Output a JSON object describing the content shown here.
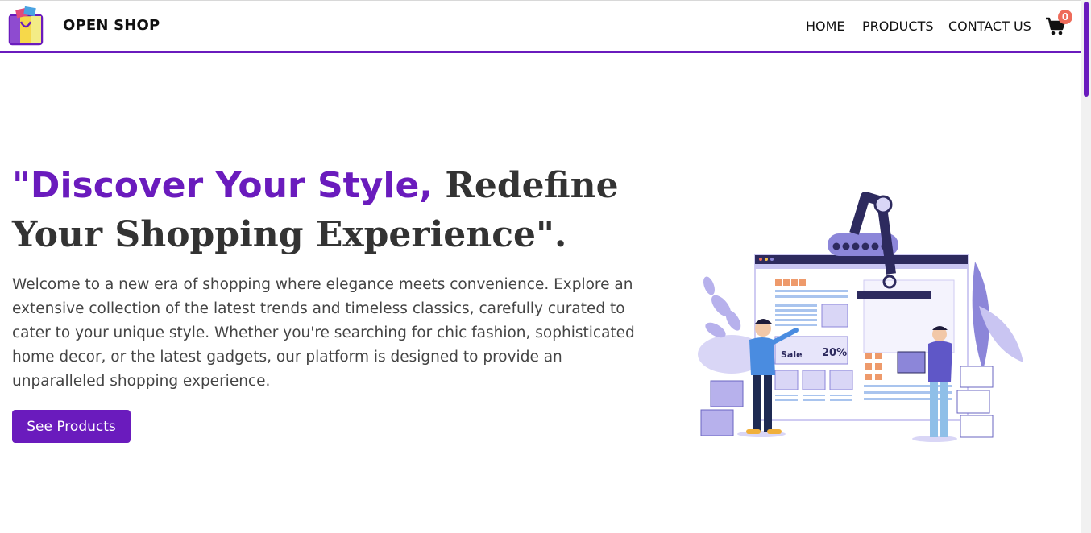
{
  "brand": {
    "name": "OPEN SHOP",
    "logo_icon": "shopping-bag-icon"
  },
  "nav": {
    "home": "HOME",
    "products": "PRODUCTS",
    "contact": "CONTACT US"
  },
  "cart": {
    "icon": "cart-icon",
    "count": "0"
  },
  "hero": {
    "title_highlight": "\"Discover Your Style,",
    "title_rest": " Redefine Your Shopping Experience\".",
    "description": "Welcome to a new era of shopping where elegance meets convenience. Explore an extensive collection of the latest trends and timeless classics, carefully curated to cater to your unique style. Whether you're searching for chic fashion, sophisticated home decor, or the latest gadgets, our platform is designed to provide an unparalleled shopping experience.",
    "cta": "See Products"
  },
  "illustration": {
    "sale_label": "Sale",
    "discount": "20%"
  },
  "colors": {
    "accent": "#6a1bbd",
    "badge": "#ee6b5a",
    "illustration": "#8c86d9"
  }
}
